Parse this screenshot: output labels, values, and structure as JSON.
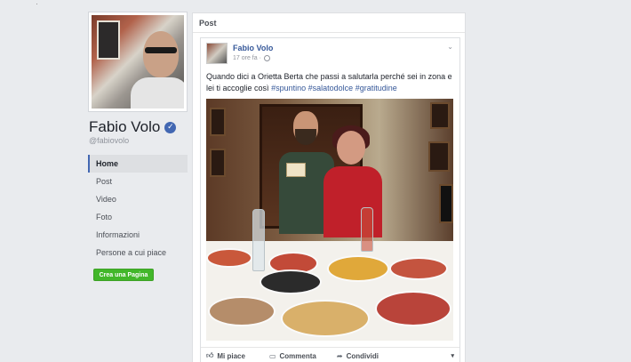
{
  "page": {
    "name": "Fabio Volo",
    "handle": "@fabiovolo",
    "verified_glyph": "✓"
  },
  "nav": {
    "items": [
      {
        "label": "Home",
        "active": true
      },
      {
        "label": "Post"
      },
      {
        "label": "Video"
      },
      {
        "label": "Foto"
      },
      {
        "label": "Informazioni"
      },
      {
        "label": "Persone a cui piace"
      }
    ],
    "create_page_label": "Crea una Pagina"
  },
  "main": {
    "section_title": "Post"
  },
  "post": {
    "author": "Fabio Volo",
    "time": "17 ore fa ·",
    "chevron_glyph": "⌄",
    "text_line1": "Quando dici a Orietta Berta che passi a salutarla perché sei in zona e",
    "text_line2_prefix": "lei ti accoglie così",
    "hashtags": [
      "#spuntino",
      "#salatodolce",
      "#gratitudine"
    ],
    "actions": {
      "like": "Mi piace",
      "comment": "Commenta",
      "share": "Condividi",
      "more_glyph": "▾"
    }
  },
  "icons": {
    "like": "thumbs-up-icon",
    "comment": "comment-icon",
    "share": "share-icon",
    "globe": "globe-icon"
  },
  "colors": {
    "background": "#e9ebee",
    "link_blue": "#365899",
    "create_green": "#42b72a",
    "verified_blue": "#4267b2"
  }
}
